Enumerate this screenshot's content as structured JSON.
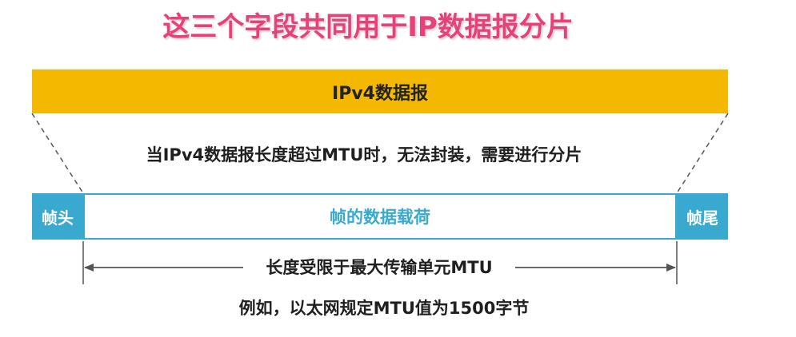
{
  "title": "这三个字段共同用于IP数据报分片",
  "datagram": {
    "label": "IPv4数据报"
  },
  "fragmentation_note": "当IPv4数据报长度超过MTU时，无法封装，需要进行分片",
  "frame": {
    "header_label": "帧头",
    "payload_label": "帧的数据载荷",
    "trailer_label": "帧尾"
  },
  "mtu": {
    "label": "长度受限于最大传输单元MTU"
  },
  "example_note": "例如，以太网规定MTU值为1500字节",
  "colors": {
    "title": "#e8407a",
    "datagram_bar": "#f5b800",
    "frame_accent": "#3aa9cf"
  }
}
